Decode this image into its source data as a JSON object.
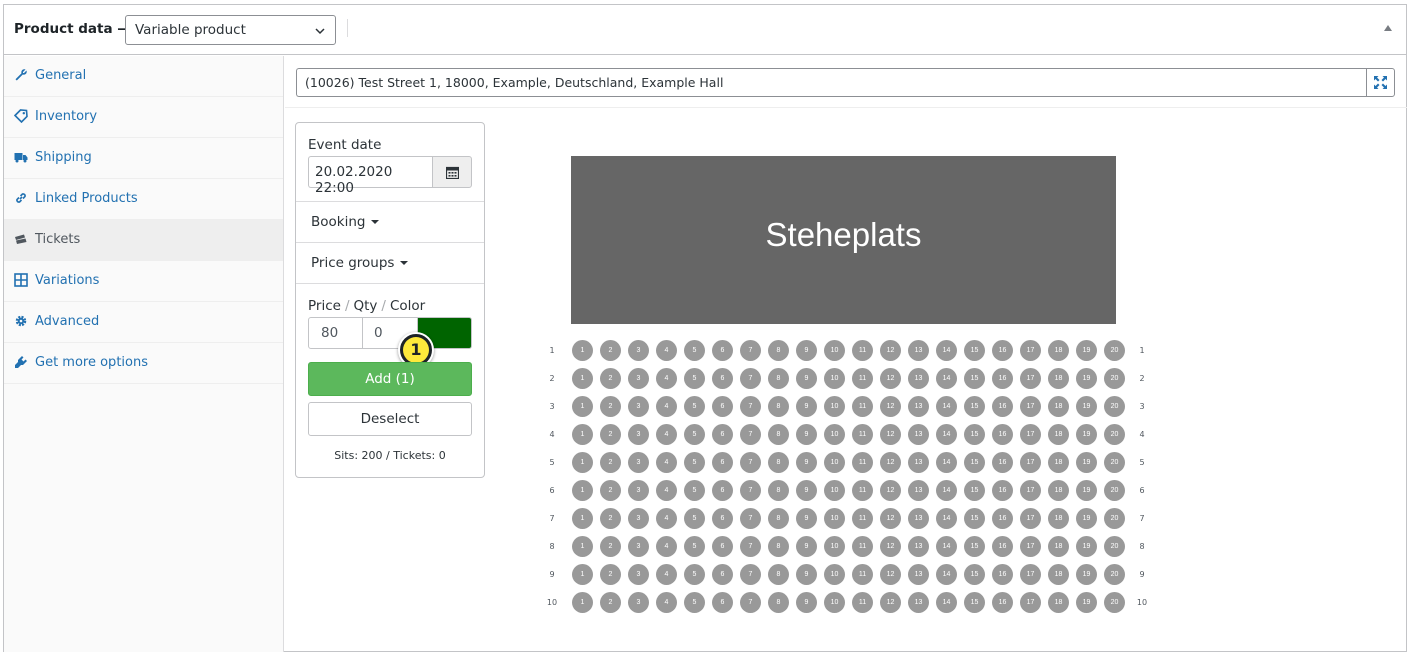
{
  "header": {
    "title": "Product data —",
    "product_type": "Variable product"
  },
  "sidebar": {
    "items": [
      {
        "label": "General",
        "icon": "wrench-icon"
      },
      {
        "label": "Inventory",
        "icon": "tag-icon"
      },
      {
        "label": "Shipping",
        "icon": "truck-icon"
      },
      {
        "label": "Linked Products",
        "icon": "link-icon"
      },
      {
        "label": "Tickets",
        "icon": "tickets-icon",
        "active": true
      },
      {
        "label": "Variations",
        "icon": "grid-icon"
      },
      {
        "label": "Advanced",
        "icon": "gear-icon"
      },
      {
        "label": "Get more options",
        "icon": "plugin-icon"
      }
    ]
  },
  "venue": {
    "address": "(10026) Test Street 1, 18000, Example, Deutschland, Example Hall"
  },
  "controls": {
    "event_date_label": "Event date",
    "event_date_value": "20.02.2020 22:00",
    "booking_label": "Booking",
    "price_groups_label": "Price groups",
    "price_label": "Price",
    "qty_label": "Qty",
    "color_label": "Color",
    "slash": "/",
    "price_value": "80",
    "qty_value": "0",
    "color_value": "#006400",
    "badge_number": "1",
    "add_label": "Add (1)",
    "deselect_label": "Deselect",
    "stats": "Sits: 200 / Tickets: 0"
  },
  "seatmap": {
    "stage_label": "Steheplats",
    "rows": [
      "1",
      "2",
      "3",
      "4",
      "5",
      "6",
      "7",
      "8",
      "9",
      "10"
    ],
    "seats": [
      "1",
      "2",
      "3",
      "4",
      "5",
      "6",
      "7",
      "8",
      "9",
      "10",
      "11",
      "12",
      "13",
      "14",
      "15",
      "16",
      "17",
      "18",
      "19",
      "20"
    ],
    "seat_color": "#999999",
    "stage_color": "#666666"
  }
}
